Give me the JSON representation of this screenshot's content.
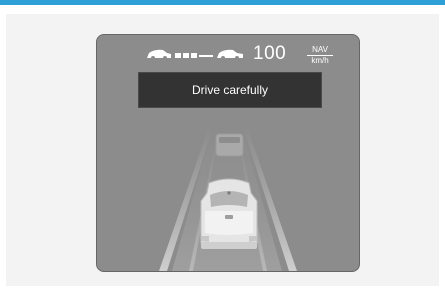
{
  "cluster": {
    "speed": "100",
    "nav_label": "NAV",
    "unit": "km/h",
    "message": "Drive carefully"
  },
  "icons": {
    "following_distance": "following-distance-icon",
    "lead_vehicle": "lead-vehicle-icon",
    "own_vehicle": "own-vehicle-icon",
    "lane_lines": "lane-lines-icon"
  },
  "colors": {
    "accent_rule": "#2f9fd8",
    "cluster_bg": "#8c8c8c",
    "message_bg": "#333333"
  }
}
